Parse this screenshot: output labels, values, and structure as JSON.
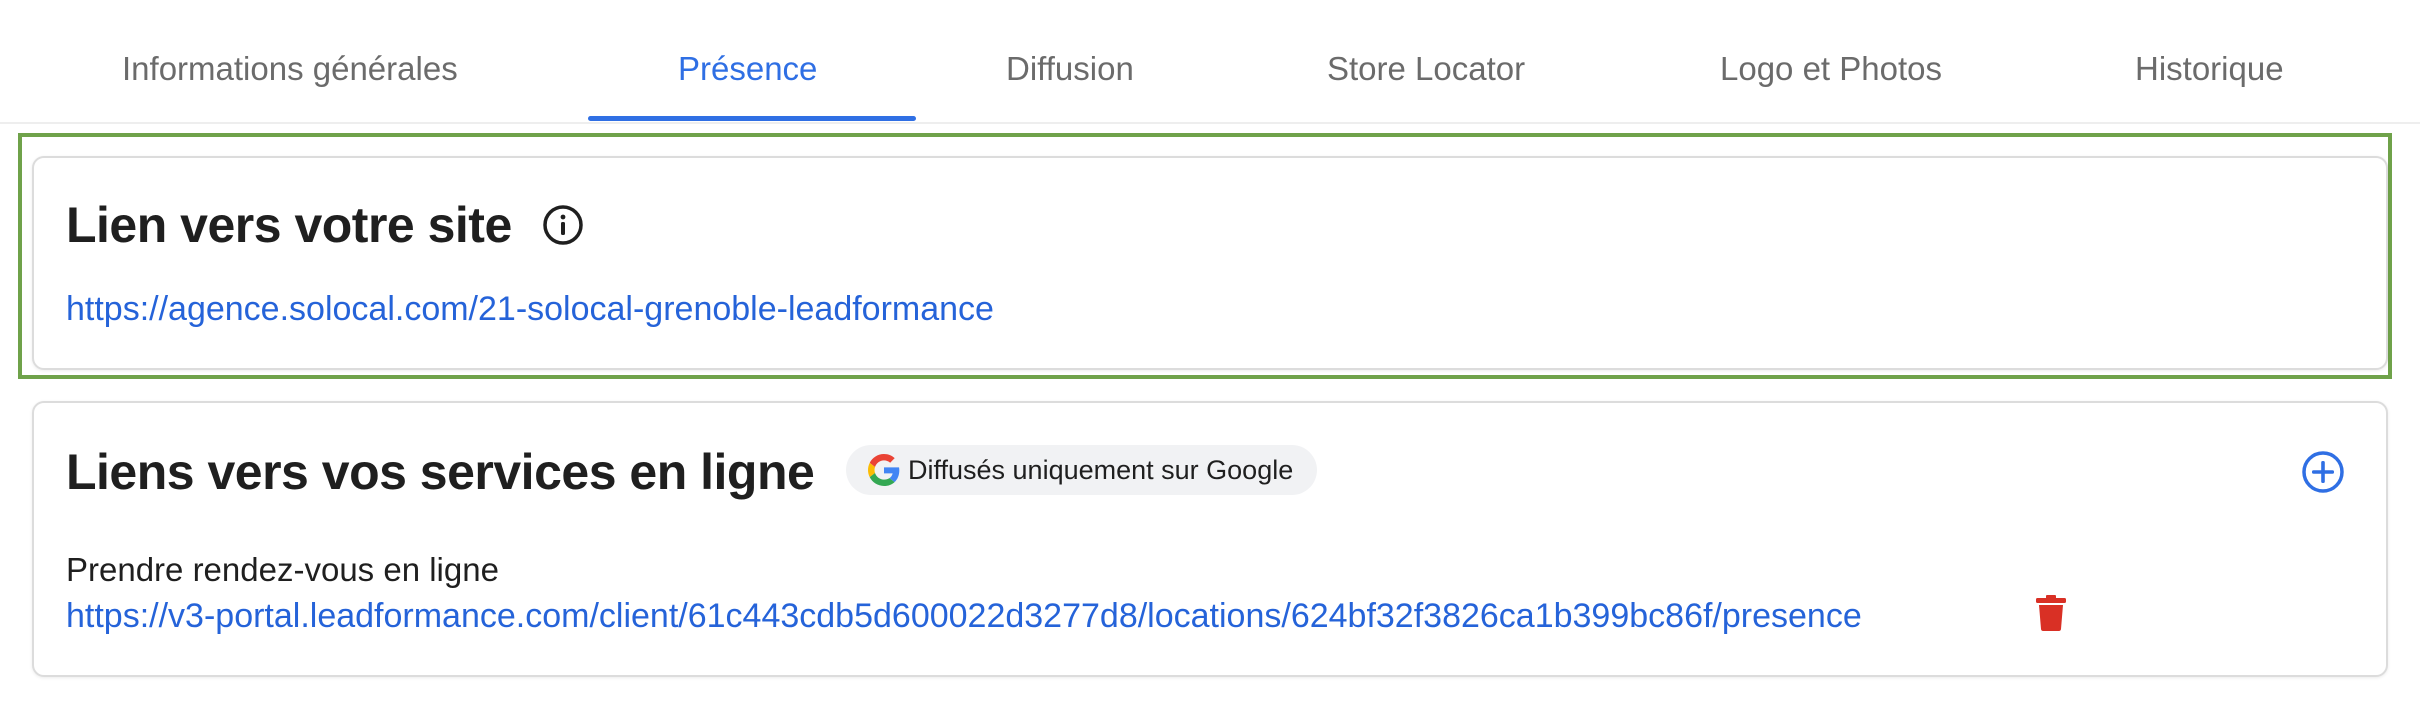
{
  "tabs": [
    {
      "label": "Informations générales",
      "active": false
    },
    {
      "label": "Présence",
      "active": true
    },
    {
      "label": "Diffusion",
      "active": false
    },
    {
      "label": "Store Locator",
      "active": false
    },
    {
      "label": "Logo et Photos",
      "active": false
    },
    {
      "label": "Historique",
      "active": false
    }
  ],
  "website_card": {
    "title": "Lien vers votre site",
    "info_icon": "info-icon",
    "url": "https://agence.solocal.com/21-solocal-grenoble-leadformance"
  },
  "services_card": {
    "title": "Liens vers vos services en ligne",
    "badge_label": "Diffusés uniquement sur Google",
    "badge_icon": "google-g-icon",
    "add_icon": "add-circle-icon",
    "services": [
      {
        "label": "Prendre rendez-vous en ligne",
        "url": "https://v3-portal.leadformance.com/client/61c443cdb5d600022d3277d8/locations/624bf32f3826ca1b399bc86f/presence",
        "delete_icon": "trash-icon"
      }
    ]
  },
  "colors": {
    "accent": "#2f6fe4",
    "link": "#2563d9",
    "highlight_border": "#6fa24a",
    "delete": "#d93025"
  }
}
